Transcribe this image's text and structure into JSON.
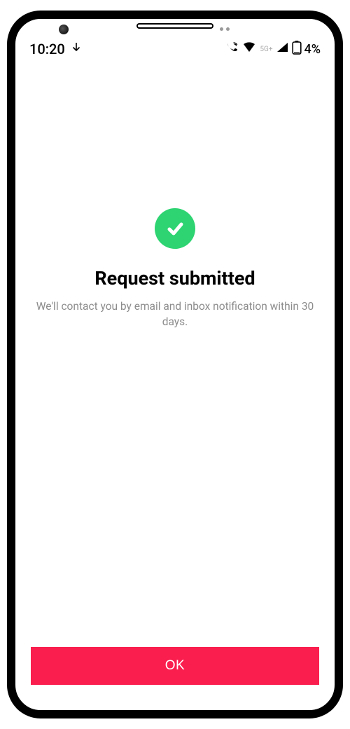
{
  "status_bar": {
    "time": "10:20",
    "network_label": "5G+",
    "battery_percent": "4%"
  },
  "success": {
    "title": "Request submitted",
    "subtitle": "We'll contact you by email and inbox notification within 30 days."
  },
  "actions": {
    "ok_label": "OK"
  },
  "colors": {
    "accent_green": "#2dd471",
    "button_red": "#fa1e4e"
  }
}
